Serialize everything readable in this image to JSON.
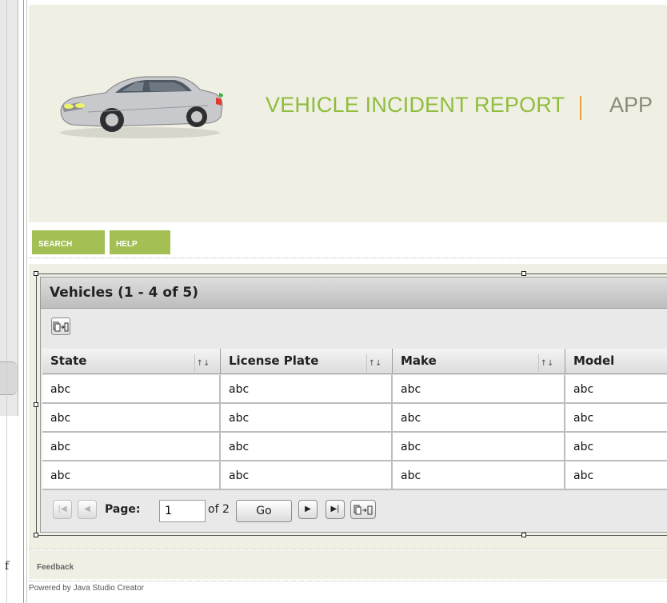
{
  "header": {
    "title": "VEHICLE INCIDENT REPORT",
    "title_cut": "APP"
  },
  "nav": {
    "search_label": "SEARCH",
    "help_label": "HELP"
  },
  "table": {
    "title": "Vehicles (1 - 4 of 5)",
    "columns": [
      "State",
      "License Plate",
      "Make",
      "Model"
    ],
    "rows": [
      [
        "abc",
        "abc",
        "abc",
        "abc"
      ],
      [
        "abc",
        "abc",
        "abc",
        "abc"
      ],
      [
        "abc",
        "abc",
        "abc",
        "abc"
      ],
      [
        "abc",
        "abc",
        "abc",
        "abc"
      ]
    ]
  },
  "pager": {
    "page_label": "Page:",
    "page_value": "1",
    "of_text": "of 2",
    "go_label": "Go"
  },
  "footer": {
    "feedback": "Feedback",
    "powered": "Powered by Java Studio Creator"
  },
  "left": {
    "glyph": "f"
  },
  "colors": {
    "accent_green": "#8fbd3c",
    "nav_green": "#a4c054",
    "header_bg": "#efefe4",
    "cursor_orange": "#e5a23e"
  }
}
